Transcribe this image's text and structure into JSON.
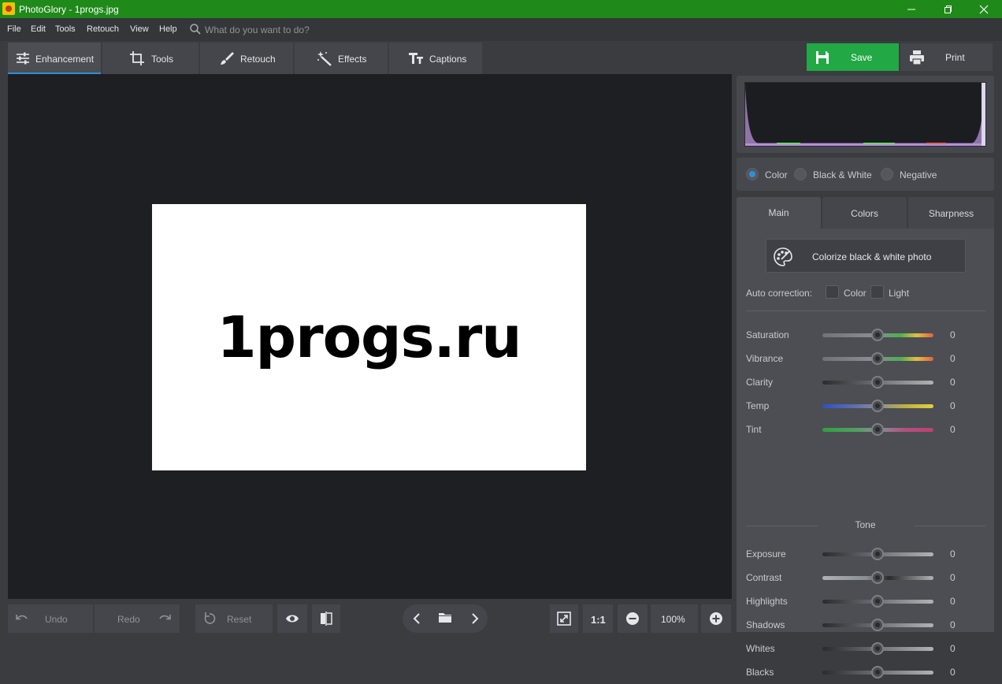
{
  "window": {
    "title": "PhotoGlory - 1progs.jpg"
  },
  "menu": {
    "items": [
      "File",
      "Edit",
      "Tools",
      "Retouch",
      "View",
      "Help"
    ],
    "search_placeholder": "What do you want to do?"
  },
  "tabs": [
    {
      "label": "Enhancement",
      "icon": "sliders-icon",
      "active": true
    },
    {
      "label": "Tools",
      "icon": "crop-icon"
    },
    {
      "label": "Retouch",
      "icon": "brush-icon"
    },
    {
      "label": "Effects",
      "icon": "magic-wand-icon"
    },
    {
      "label": "Captions",
      "icon": "text-icon"
    }
  ],
  "actions": {
    "save_label": "Save",
    "print_label": "Print",
    "save_color": "#22a845"
  },
  "photo": {
    "text": "1progs.ru"
  },
  "bottom": {
    "undo_label": "Undo",
    "redo_label": "Redo",
    "reset_label": "Reset",
    "zoom_one_to_one": "1:1",
    "zoom_level": "100%"
  },
  "modes": {
    "color": "Color",
    "bw": "Black & White",
    "negative": "Negative",
    "selected": "Color"
  },
  "settings_tabs": {
    "main": "Main",
    "colors": "Colors",
    "sharpness": "Sharpness",
    "active": "Main"
  },
  "main_panel": {
    "colorize_label": "Colorize black & white photo",
    "auto_correction_label": "Auto correction:",
    "auto_color_label": "Color",
    "auto_light_label": "Light",
    "color_sliders": [
      {
        "name": "Saturation",
        "value": "0"
      },
      {
        "name": "Vibrance",
        "value": "0"
      },
      {
        "name": "Clarity",
        "value": "0"
      },
      {
        "name": "Temp",
        "value": "0"
      },
      {
        "name": "Tint",
        "value": "0"
      }
    ],
    "tone_label": "Tone",
    "tone_sliders": [
      {
        "name": "Exposure",
        "value": "0"
      },
      {
        "name": "Contrast",
        "value": "0"
      },
      {
        "name": "Highlights",
        "value": "0"
      },
      {
        "name": "Shadows",
        "value": "0"
      },
      {
        "name": "Whites",
        "value": "0"
      },
      {
        "name": "Blacks",
        "value": "0"
      }
    ]
  },
  "accent_color": "#2f8fd8"
}
